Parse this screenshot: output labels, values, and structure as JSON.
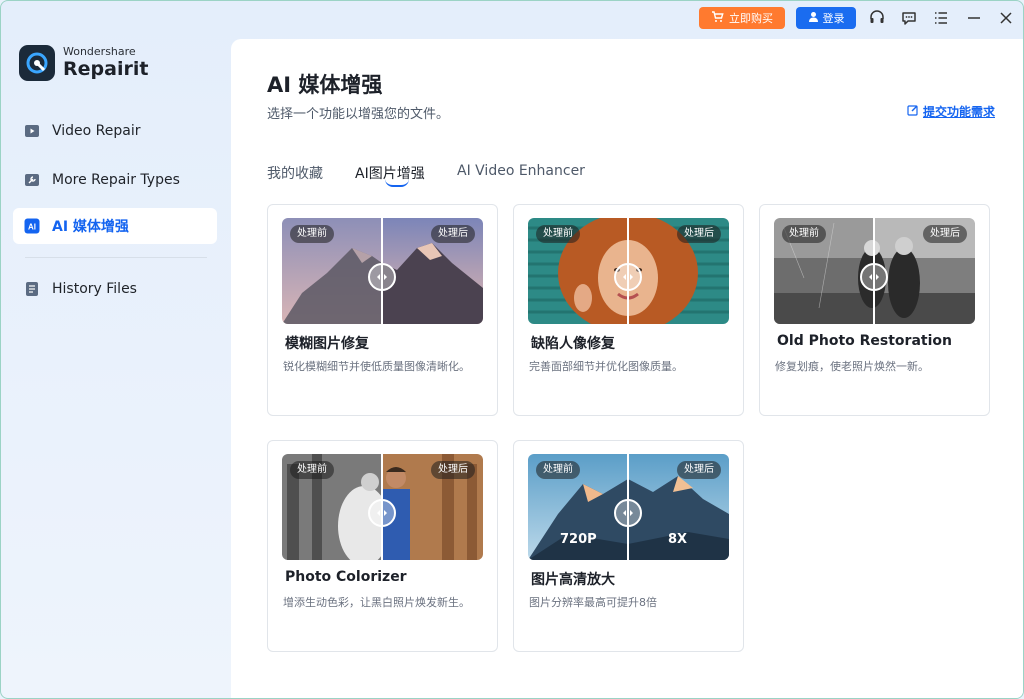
{
  "titlebar": {
    "buy_label": "立即购买",
    "login_label": "登录",
    "icons": [
      "support-icon",
      "chat-icon",
      "menu-icon",
      "minimize-icon",
      "close-icon"
    ]
  },
  "sidebar": {
    "brand_top": "Wondershare",
    "brand_main": "Repairit",
    "items": [
      {
        "label": "Video Repair",
        "icon": "video-icon"
      },
      {
        "label": "More Repair Types",
        "icon": "wrench-icon"
      },
      {
        "label": "AI 媒体增强",
        "icon": "ai-icon",
        "active": true
      },
      {
        "label": "History Files",
        "icon": "file-list-icon"
      }
    ]
  },
  "main": {
    "title": "AI 媒体增强",
    "subtitle": "选择一个功能以增强您的文件。",
    "feedback_label": "提交功能需求",
    "tabs": [
      {
        "label": "我的收藏"
      },
      {
        "label": "AI图片增强",
        "active": true
      },
      {
        "label": "AI Video Enhancer"
      }
    ],
    "before_label": "处理前",
    "after_label": "处理后",
    "cards": [
      {
        "title": "模糊图片修复",
        "desc": "锐化模糊细节并使低质量图像清晰化。"
      },
      {
        "title": "缺陷人像修复",
        "desc": "完善面部细节并优化图像质量。"
      },
      {
        "title": "Old Photo Restoration",
        "desc": "修复划痕，使老照片焕然一新。"
      },
      {
        "title": "Photo Colorizer",
        "desc": "增添生动色彩，让黑白照片焕发新生。"
      },
      {
        "title": "图片高清放大",
        "desc": "图片分辨率最高可提升8倍",
        "res_before": "720P",
        "res_after": "8X"
      }
    ]
  },
  "colors": {
    "accent": "#1464f0",
    "buy": "#ff7a2f",
    "login": "#1a6cf0"
  }
}
